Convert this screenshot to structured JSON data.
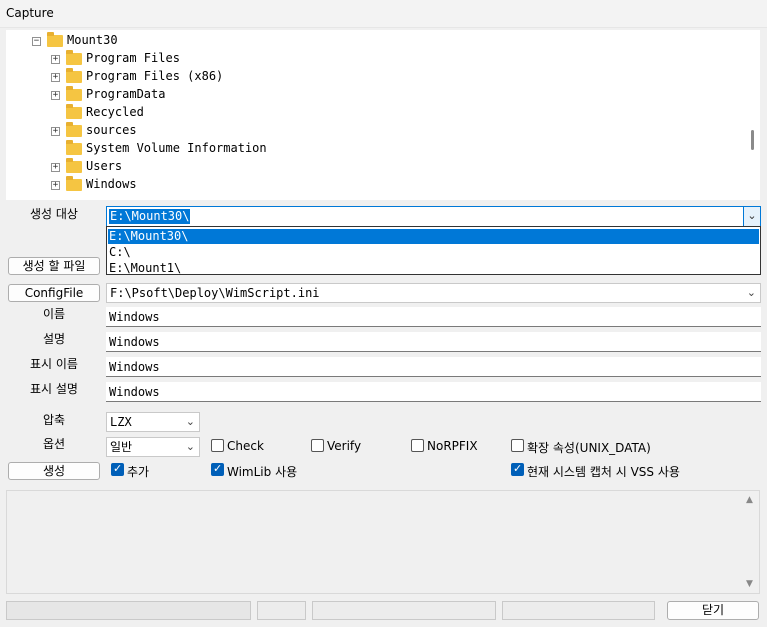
{
  "window": {
    "title": "Capture"
  },
  "tree": {
    "root": "Mount30",
    "children": [
      {
        "label": "Program Files"
      },
      {
        "label": "Program Files (x86)"
      },
      {
        "label": "ProgramData"
      },
      {
        "label": "Recycled"
      },
      {
        "label": "sources"
      },
      {
        "label": "System Volume Information"
      },
      {
        "label": "Users"
      },
      {
        "label": "Windows"
      }
    ]
  },
  "form": {
    "target_label": "생성 대상",
    "target_value": "E:\\Mount30\\",
    "target_options": [
      "E:\\Mount30\\",
      "C:\\",
      "E:\\Mount1\\"
    ],
    "file_button": "생성 할 파일",
    "config_button": "ConfigFile",
    "config_value": "F:\\Psoft\\Deploy\\WimScript.ini",
    "name_label": "이름",
    "name_value": "Windows",
    "desc_label": "설명",
    "desc_value": "Windows",
    "disp_name_label": "표시 이름",
    "disp_name_value": "Windows",
    "disp_desc_label": "표시 설명",
    "disp_desc_value": "Windows",
    "compress_label": "압축",
    "compress_value": "LZX",
    "option_label": "옵션",
    "option_value": "일반",
    "check_label": "Check",
    "verify_label": "Verify",
    "norpfix_label": "NoRPFIX",
    "ext_attr_label": "확장 속성(UNIX_DATA)",
    "create_button": "생성",
    "append_label": "추가",
    "wimlib_label": "WimLib 사용",
    "vss_label": "현재 시스템 캡처 시 VSS 사용"
  },
  "footer": {
    "close_button": "닫기"
  }
}
